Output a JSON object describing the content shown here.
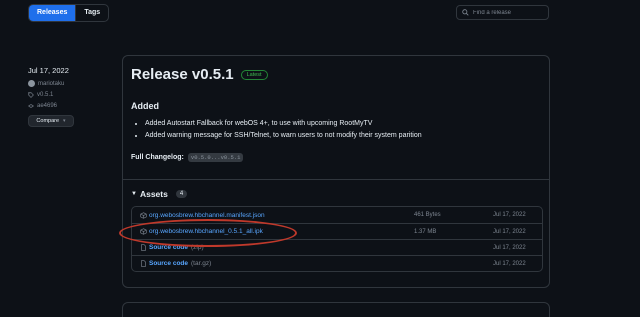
{
  "tabs": {
    "releases": "Releases",
    "tags": "Tags"
  },
  "search": {
    "placeholder": "Find a release"
  },
  "meta": {
    "date": "Jul 17, 2022",
    "author": "mariotaku",
    "tag": "v0.5.1",
    "commit": "ae4696",
    "compare": "Compare"
  },
  "release": {
    "title": "Release v0.5.1",
    "badge": "Latest",
    "section": "Added",
    "bullets": [
      "Added Autostart Fallback for webOS 4+, to use with upcoming RootMyTV",
      "Added warning message for SSH/Telnet, to warn users to not modify their system parition"
    ],
    "changelog_label": "Full Changelog:",
    "changelog_ref": "v0.5.0...v0.5.1",
    "assets_label": "Assets",
    "assets_count": "4",
    "assets": [
      {
        "name": "org.webosbrew.hbchannel.manifest.json",
        "size": "461 Bytes",
        "date": "Jul 17, 2022"
      },
      {
        "name": "org.webosbrew.hbchannel_0.5.1_all.ipk",
        "size": "1.37 MB",
        "date": "Jul 17, 2022"
      },
      {
        "name": "Source code",
        "ext": "(zip)",
        "date": "Jul 17, 2022"
      },
      {
        "name": "Source code",
        "ext": "(tar.gz)",
        "date": "Jul 17, 2022"
      }
    ]
  },
  "colors": {
    "accent": "#1f6feb",
    "link": "#58a6ff",
    "latest": "#3fb950",
    "highlight": "#c0392b"
  }
}
